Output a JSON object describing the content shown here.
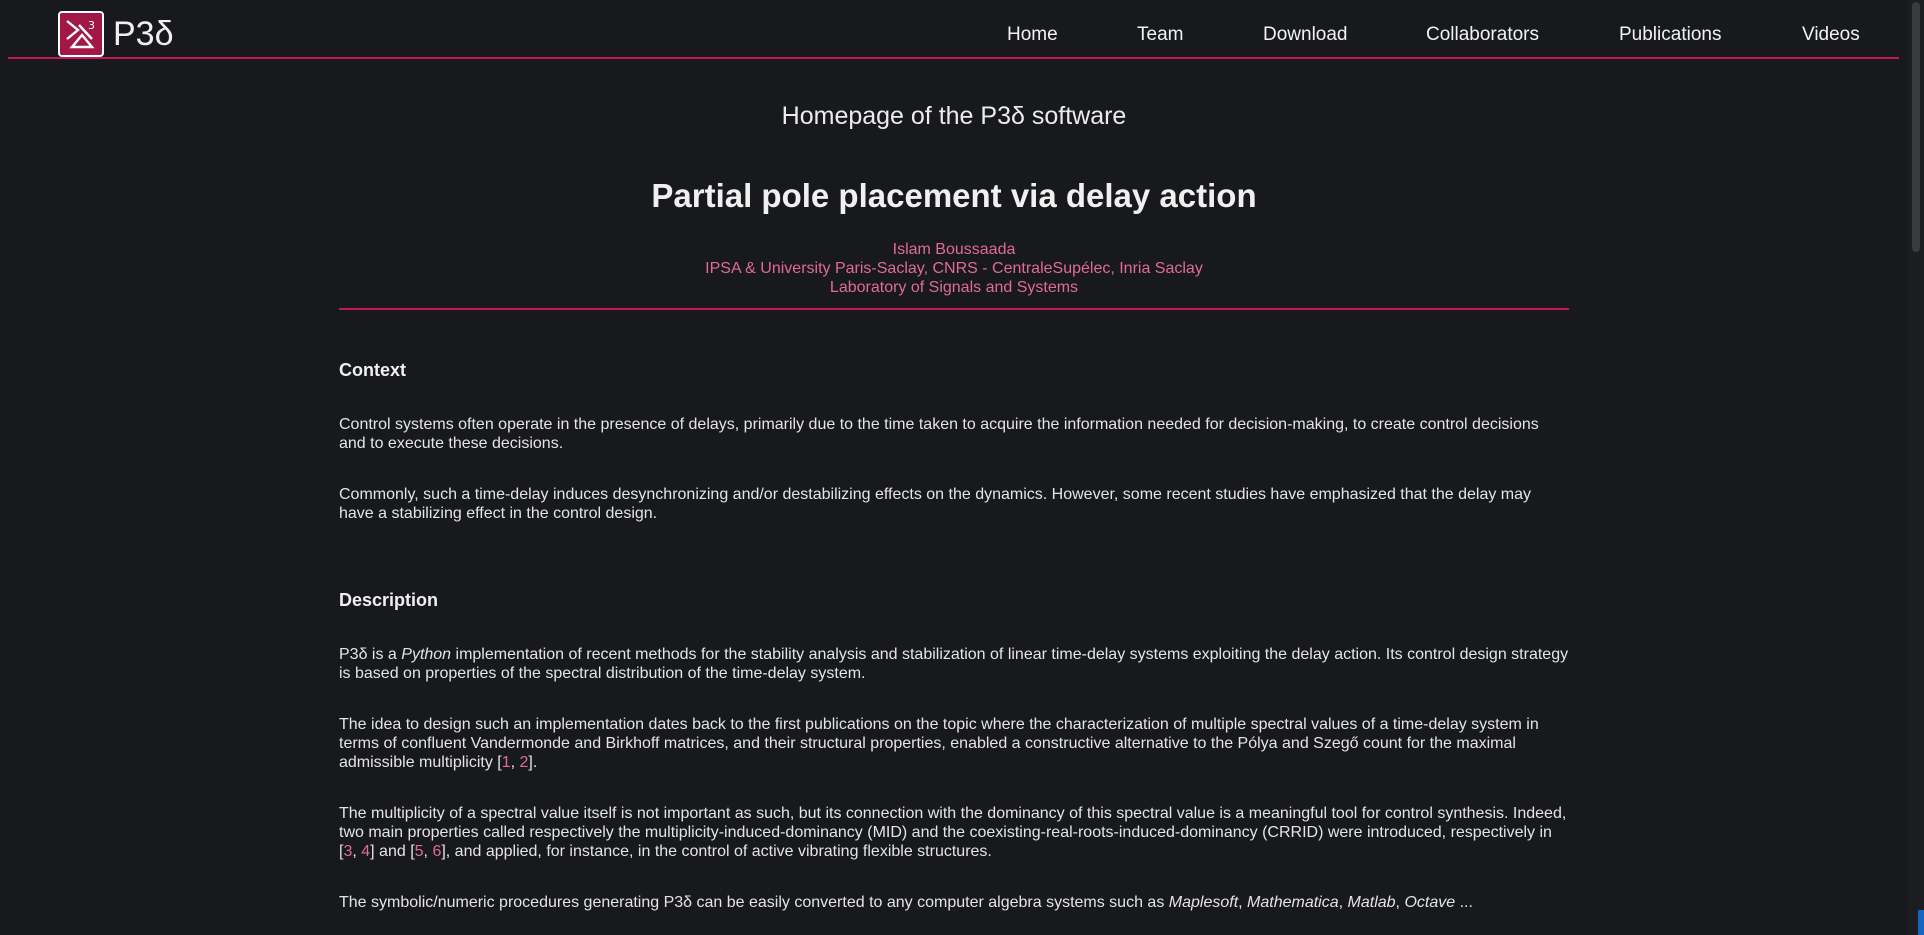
{
  "nav": {
    "brand": "P3δ",
    "links": [
      "Home",
      "Team",
      "Download",
      "Collaborators",
      "Publications",
      "Videos"
    ]
  },
  "header": {
    "subtitle": "Homepage of the P3δ software",
    "title": "Partial pole placement via delay action",
    "author": "Islam Boussaada",
    "affiliation": "IPSA & University Paris-Saclay, CNRS - CentraleSupélec, Inria Saclay",
    "lab": "Laboratory of Signals and Systems"
  },
  "context": {
    "heading": "Context",
    "p1": "Control systems often operate in the presence of delays, primarily due to the time taken to acquire the information needed for decision-making, to create control decisions and to execute these decisions.",
    "p2": "Commonly, such a time-delay induces desynchronizing and/or destabilizing effects on the dynamics. However, some recent studies have emphasized that the delay may have a stabilizing effect in the control design."
  },
  "description": {
    "heading": "Description",
    "p1_a": "P3δ is a ",
    "p1_em": "Python",
    "p1_b": " implementation of recent methods for the stability analysis and stabilization of linear time-delay systems exploiting the delay action. Its control design strategy is based on properties of the spectral distribution of the time-delay system.",
    "p2_a": "The idea to design such an implementation dates back to the first publications on the topic where the characterization of multiple spectral values of a time-delay system in terms of confluent Vandermonde and Birkhoff matrices, and their structural properties, enabled a constructive alternative to the Pólya and Szegő count for the maximal admissible multiplicity [",
    "p2_ref1": "1",
    "p2_sep": ", ",
    "p2_ref2": "2",
    "p2_end": "].",
    "p3_a": "The multiplicity of a spectral value itself is not important as such, but its connection with the dominancy of this spectral value is a meaningful tool for control synthesis. Indeed, two main properties called respectively the multiplicity-induced-dominancy (MID) and the coexisting-real-roots-induced-dominancy (CRRID) were introduced, respectively in [",
    "p3_ref3": "3",
    "p3_sep1": ", ",
    "p3_ref4": "4",
    "p3_mid": "] and [",
    "p3_ref5": "5",
    "p3_sep2": ", ",
    "p3_ref6": "6",
    "p3_b": "], and applied, for instance, in the control of active vibrating flexible structures.",
    "p4_a": "The symbolic/numeric procedures generating P3δ can be easily converted to any computer algebra systems such as ",
    "p4_em1": "Maplesoft",
    "p4_c1": ", ",
    "p4_em2": "Mathematica",
    "p4_c2": ", ",
    "p4_em3": "Matlab",
    "p4_c3": ", ",
    "p4_em4": "Octave",
    "p4_end": " ..."
  }
}
